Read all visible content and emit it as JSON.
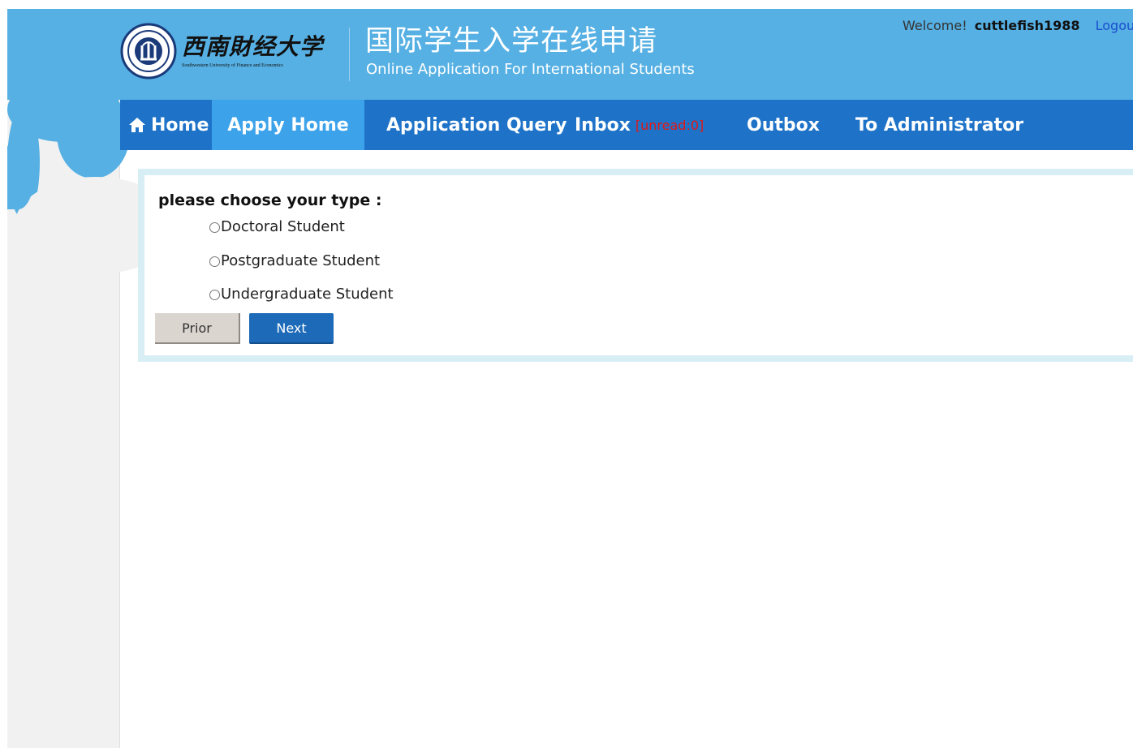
{
  "header": {
    "logo_cn": "西南財经大学",
    "logo_en": "Southwestern University of Finance and Economics",
    "title_cn": "国际学生入学在线申请",
    "title_en": "Online Application For International Students",
    "welcome_label": "Welcome!",
    "username": "cuttlefish1988",
    "logout_label": "Logout"
  },
  "nav": {
    "home": "Home",
    "apply_home": "Apply Home",
    "application_query": "Application Query",
    "inbox": "Inbox",
    "inbox_unread": "[unread:0]",
    "outbox": "Outbox",
    "to_admin": "To Administrator"
  },
  "form": {
    "prompt": "please choose your type :",
    "options": [
      {
        "label": "Doctoral Student",
        "selected": false
      },
      {
        "label": "Postgraduate Student",
        "selected": false
      },
      {
        "label": "Undergraduate Student",
        "selected": false
      }
    ],
    "prior_label": "Prior",
    "next_label": "Next"
  },
  "colors": {
    "header_blue": "#56b0e3",
    "nav_blue": "#1e73c8",
    "nav_active": "#3ca2ea",
    "unread_red": "#e01818",
    "next_button": "#1d6bb8"
  },
  "icons": {
    "home": "home-icon",
    "logo": "university-seal-icon"
  }
}
